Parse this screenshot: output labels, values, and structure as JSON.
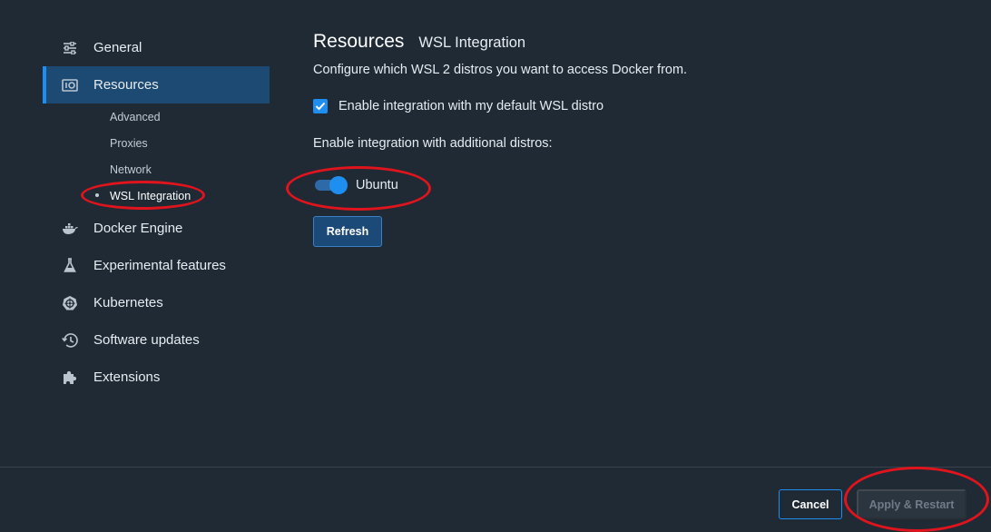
{
  "sidebar": {
    "items": [
      {
        "label": "General",
        "icon": "sliders-icon"
      },
      {
        "label": "Resources",
        "icon": "resources-icon"
      },
      {
        "label": "Docker Engine",
        "icon": "whale-icon"
      },
      {
        "label": "Experimental features",
        "icon": "flask-icon"
      },
      {
        "label": "Kubernetes",
        "icon": "helm-icon"
      },
      {
        "label": "Software updates",
        "icon": "history-icon"
      },
      {
        "label": "Extensions",
        "icon": "puzzle-icon"
      }
    ],
    "active": "Resources",
    "sub_items": [
      {
        "label": "Advanced"
      },
      {
        "label": "Proxies"
      },
      {
        "label": "Network"
      },
      {
        "label": "WSL Integration"
      }
    ],
    "active_sub": "WSL Integration"
  },
  "main": {
    "title": "Resources",
    "subtitle": "WSL Integration",
    "description": "Configure which WSL 2 distros you want to access Docker from.",
    "default_distro_checkbox": {
      "label": "Enable integration with my default WSL distro",
      "checked": true
    },
    "additional_label": "Enable integration with additional distros:",
    "distros": [
      {
        "label": "Ubuntu",
        "enabled": true
      }
    ],
    "refresh_label": "Refresh"
  },
  "footer": {
    "cancel_label": "Cancel",
    "apply_label": "Apply & Restart",
    "apply_enabled": false
  },
  "colors": {
    "background": "#1f2a35",
    "accent": "#1f8ef1",
    "active_nav": "#1d4a72",
    "annotation": "#e0141c"
  }
}
